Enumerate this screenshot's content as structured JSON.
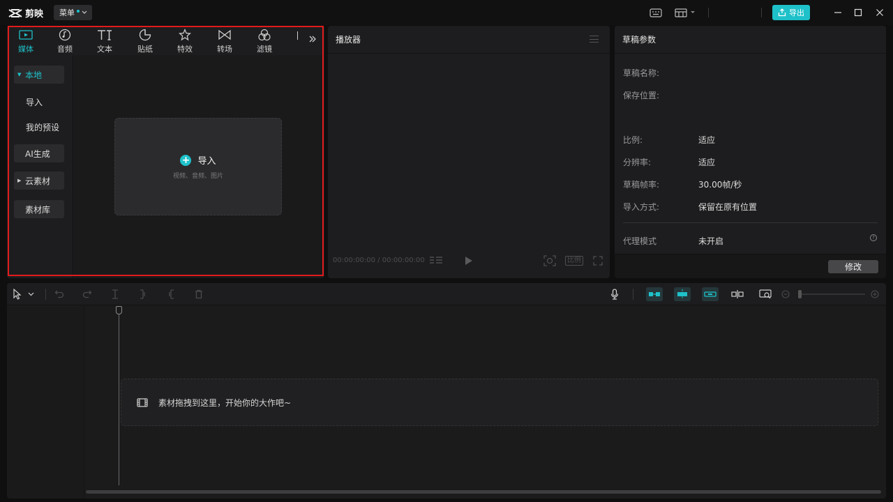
{
  "app": {
    "logo_text": "剪映",
    "menu_label": "菜单",
    "export_label": "导出"
  },
  "media_panel": {
    "tabs": [
      {
        "label": "媒体",
        "icon": "media-icon",
        "active": true
      },
      {
        "label": "音频",
        "icon": "audio-icon",
        "active": false
      },
      {
        "label": "文本",
        "icon": "text-icon",
        "active": false
      },
      {
        "label": "贴纸",
        "icon": "sticker-icon",
        "active": false
      },
      {
        "label": "特效",
        "icon": "effects-icon",
        "active": false
      },
      {
        "label": "转场",
        "icon": "transition-icon",
        "active": false
      },
      {
        "label": "滤镜",
        "icon": "filter-icon",
        "active": false
      }
    ],
    "sidebar": [
      {
        "label": "本地",
        "selected": true
      },
      {
        "label": "导入"
      },
      {
        "label": "我的预设"
      },
      {
        "label": "AI生成"
      },
      {
        "label": "云素材"
      },
      {
        "label": "素材库"
      }
    ],
    "import": {
      "label": "导入",
      "hint": "视频、音频、图片"
    }
  },
  "player": {
    "title": "播放器",
    "timecode": "00:00:00:00 / 00:00:00:00",
    "ratio_label": "比例"
  },
  "draft": {
    "title": "草稿参数",
    "rows": [
      {
        "label": "草稿名称:",
        "value": ""
      },
      {
        "label": "保存位置:",
        "value": ""
      },
      {
        "label": "比例:",
        "value": "适应"
      },
      {
        "label": "分辨率:",
        "value": "适应"
      },
      {
        "label": "草稿帧率:",
        "value": "30.00帧/秒"
      },
      {
        "label": "导入方式:",
        "value": "保留在原有位置"
      },
      {
        "label": "代理模式",
        "value": "未开启"
      }
    ],
    "modify_label": "修改"
  },
  "timeline": {
    "drop_hint": "素材拖拽到这里，开始你的大作吧~"
  },
  "colors": {
    "accent": "#1ec1c9",
    "highlight_outline": "#e21b1b"
  }
}
